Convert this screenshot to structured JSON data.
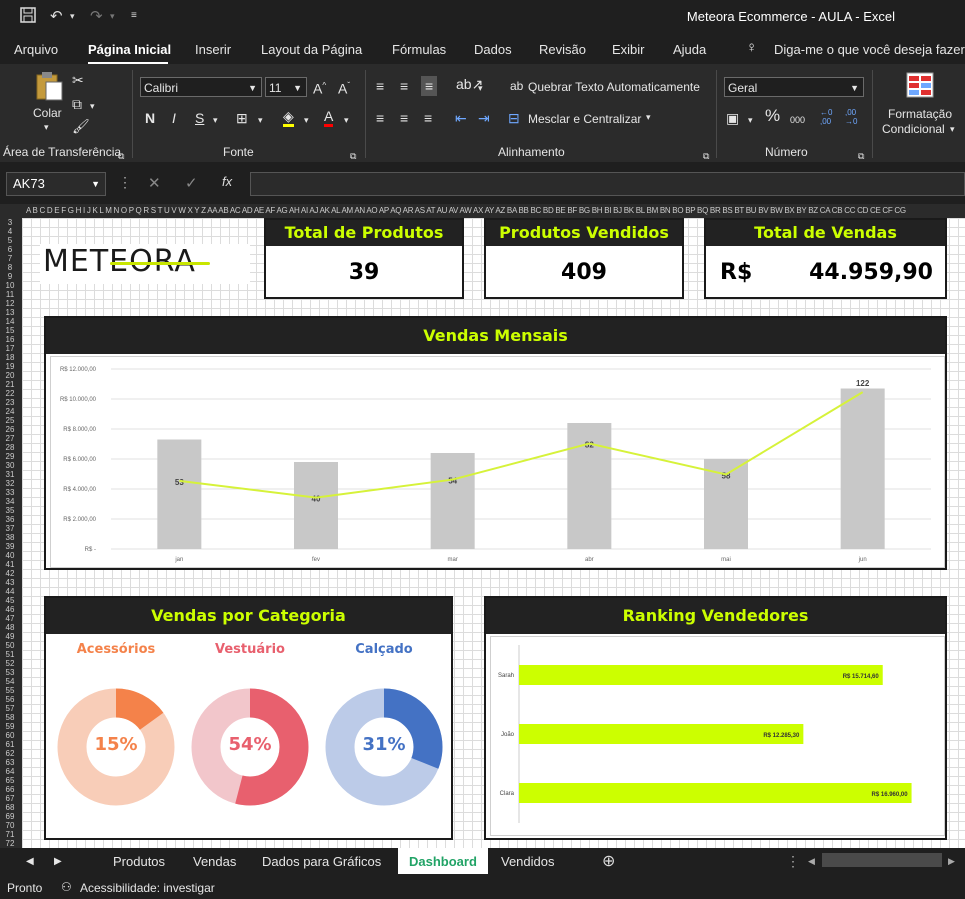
{
  "window": {
    "title": "Meteora Ecommerce - AULA  -  Excel"
  },
  "menu": [
    "Arquivo",
    "Página Inicial",
    "Inserir",
    "Layout da Página",
    "Fórmulas",
    "Dados",
    "Revisão",
    "Exibir",
    "Ajuda"
  ],
  "tell_me": "Diga-me o que você deseja fazer",
  "ribbon": {
    "clipboard": {
      "paste": "Colar",
      "group": "Área de Transferência"
    },
    "font": {
      "name": "Calibri",
      "size": "11",
      "group": "Fonte",
      "bold": "N",
      "italic": "I",
      "underline": "S"
    },
    "alignment": {
      "wrap": "Quebrar Texto Automaticamente",
      "merge": "Mesclar e Centralizar",
      "group": "Alinhamento"
    },
    "number": {
      "format": "Geral",
      "group": "Número"
    },
    "styles": {
      "cond1": "Formatação",
      "cond2": "Condicional"
    }
  },
  "formula_bar": {
    "name_box": "AK73",
    "fx": "fx"
  },
  "columns": "A B C D E F G H I J K L M N O P Q R S T U V W X Y Z AA AB AC AD AE AF AG AH AI AJ AK AL AM AN AO AP AQ AR AS AT AU AV AW AX AY AZ BA BB BC BD BE BF BG BH BI BJ BK BL BM BN BO BP BQ BR BS BT BU BV BW BX BY BZ CA CB CC CD CE CF CG",
  "dashboard": {
    "logo": "METEORA",
    "kpis": [
      {
        "title": "Total de Produtos",
        "value": "39"
      },
      {
        "title": "Produtos  Vendidos",
        "value": "409"
      },
      {
        "title": "Total de Vendas",
        "currency": "R$",
        "value": "44.959,90"
      }
    ],
    "monthly_title": "Vendas Mensais",
    "category_title": "Vendas por Categoria",
    "ranking_title": "Ranking Vendedores",
    "categories": [
      {
        "name": "Acessórios",
        "pct": "15%",
        "value": 0.15,
        "color": "#f4824a",
        "light": "#f8cdb8"
      },
      {
        "name": "Vestuário",
        "pct": "54%",
        "value": 0.54,
        "color": "#e8606e",
        "light": "#f2c6cb"
      },
      {
        "name": "Calçado",
        "pct": "31%",
        "value": 0.31,
        "color": "#4472c4",
        "light": "#bccbe8"
      }
    ]
  },
  "chart_data": [
    {
      "type": "bar",
      "title": "Vendas Mensais",
      "categories": [
        "jan",
        "fev",
        "mar",
        "abr",
        "mai",
        "jun"
      ],
      "series": [
        {
          "values": [
            7300,
            5800,
            6400,
            8400,
            6000,
            10700
          ],
          "color": "#c8c8c8"
        },
        {
          "values": [
            53,
            40,
            54,
            82,
            58,
            122
          ],
          "color": "#d6f23a",
          "render": "line"
        }
      ],
      "ylim": [
        0,
        12000
      ],
      "yticks": [
        "R$ -",
        "R$ 2.000,00",
        "R$ 4.000,00",
        "R$ 6.000,00",
        "R$ 8.000,00",
        "R$ 10.000,00",
        "R$ 12.000,00"
      ],
      "line_ylim": [
        0,
        140
      ],
      "grid": true
    },
    {
      "type": "bar",
      "title": "Ranking Vendedores",
      "orientation": "horizontal",
      "categories": [
        "Sarah",
        "João",
        "Clara"
      ],
      "values": [
        15714.6,
        12285.3,
        16960.0
      ],
      "labels": [
        "R$ 15.714,60",
        "R$ 12.285,30",
        "R$ 16.960,00"
      ],
      "color": "#ccff00",
      "xlim": [
        0,
        17800
      ]
    }
  ],
  "sheets": [
    "Produtos",
    "Vendas",
    "Dados para Gráficos",
    "Dashboard",
    "Vendidos"
  ],
  "status": {
    "ready": "Pronto",
    "accessibility": "Acessibilidade: investigar"
  }
}
